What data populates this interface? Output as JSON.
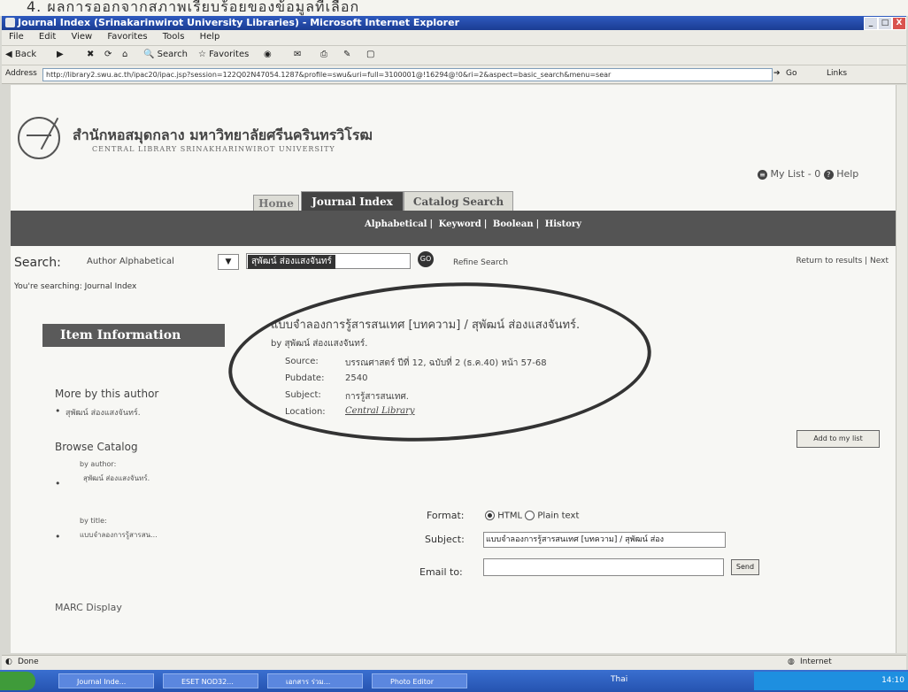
{
  "caption": "4. ผลการออกจากสภาพเรียบร้อยของข้อมูลที่เลือก",
  "window": {
    "title": "Journal Index (Srinakarinwirot University Libraries) - Microsoft Internet Explorer",
    "minimize": "_",
    "maximize": "□",
    "close": "X"
  },
  "menu": [
    "File",
    "Edit",
    "View",
    "Favorites",
    "Tools",
    "Help"
  ],
  "toolbar": {
    "back": "Back",
    "search": "Search",
    "favorites": "Favorites"
  },
  "address": {
    "label": "Address",
    "url": "http://library2.swu.ac.th/ipac20/ipac.jsp?session=122Q02N47054.1287&profile=swu&uri=full=3100001@!16294@!0&ri=2&aspect=basic_search&menu=sear",
    "go": "Go",
    "links": "Links"
  },
  "header": {
    "library_thai": "สำนักหอสมุดกลาง มหาวิทยาลัยศรีนครินทรวิโรฒ",
    "library_en": "CENTRAL LIBRARY SRINAKHARINWIROT UNIVERSITY",
    "my_list": "My List - 0",
    "help": "Help"
  },
  "tabs": {
    "home": "Home",
    "journal": "Journal Index",
    "catalog": "Catalog Search"
  },
  "subnav": {
    "alphabetical": "Alphabetical",
    "keyword": "Keyword",
    "boolean": "Boolean",
    "history": "History"
  },
  "search": {
    "label": "Search:",
    "type": "Author Alphabetical",
    "value": "สุพัฒน์ ส่องแสงจันทร์",
    "refine": "Refine Search",
    "return_results": "Return to results",
    "next": "Next",
    "searching": "You're searching: Journal Index"
  },
  "item": {
    "section": "Item Information",
    "title": "แบบจำลองการรู้สารสนเทศ [บทความ] / สุพัฒน์ ส่องแสงจันทร์.",
    "by": "by สุพัฒน์ ส่องแสงจันทร์.",
    "source_label": "Source:",
    "source": "บรรณศาสตร์ ปีที่ 12, ฉบับที่ 2 (ธ.ค.40) หน้า 57-68",
    "pubdate_label": "Pubdate:",
    "pubdate": "2540",
    "subject_label": "Subject:",
    "subject": "การรู้สารสนเทศ.",
    "location_label": "Location:",
    "location": "Central Library"
  },
  "sidebar": {
    "more_by_author": "More by this author",
    "author_item": "สุพัฒน์ ส่องแสงจันทร์.",
    "browse_catalog": "Browse Catalog",
    "by_author": "by author:",
    "author_browse_item": "สุพัฒน์ ส่องแสงจันทร์.",
    "by_title": "by title:",
    "title_browse_item": "แบบจำลองการรู้สารสน...",
    "marc": "MARC Display"
  },
  "add_to_list": "Add to my list",
  "email_form": {
    "format_label": "Format:",
    "format_html": "HTML",
    "format_plain": "Plain text",
    "subject_label": "Subject:",
    "subject_value": "แบบจำลองการรู้สารสนเทศ [บทความ] / สุพัฒน์ ส่อง",
    "email_label": "Email to:",
    "send": "Send"
  },
  "status": {
    "done": "Done",
    "zone": "Internet"
  },
  "taskbar": {
    "tasks": [
      "Journal Inde...",
      "ESET NOD32...",
      "เอกสาร ร่วม...",
      "Photo Editor"
    ],
    "center": "Thai",
    "clock": "14:10"
  }
}
